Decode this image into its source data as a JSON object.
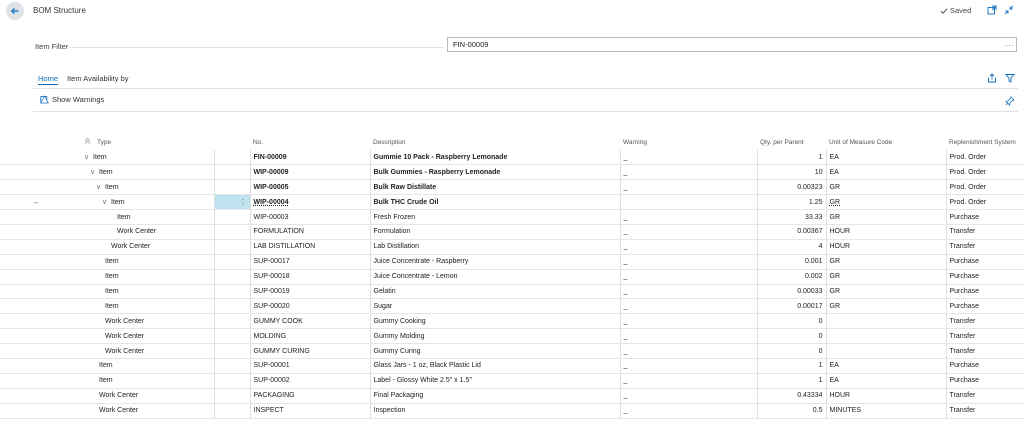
{
  "header": {
    "title": "BOM Structure",
    "saved_label": "Saved"
  },
  "filter": {
    "label": "Item Filter",
    "value": "FIN-00009",
    "more": "···"
  },
  "tabs": [
    {
      "label": "Home"
    },
    {
      "label": "Item Availability by"
    }
  ],
  "actions": {
    "show_warnings": "Show Warnings"
  },
  "columns": [
    "Type",
    "No.",
    "Description",
    "Warning",
    "Qty. per Parent",
    "Unit of Measure Code",
    "Replenishment System"
  ],
  "rows": [
    {
      "type": "Item",
      "level": 0,
      "expand": true,
      "no": "FIN-00009",
      "desc": "Gummie 10 Pack - Raspberry Lemonade",
      "warning": "_",
      "qty": "1",
      "uom": "EA",
      "repl": "Prod. Order",
      "bold": true
    },
    {
      "type": "Item",
      "level": 1,
      "expand": true,
      "no": "WIP-00009",
      "desc": "Bulk Gummies - Raspberry Lemonade",
      "warning": "_",
      "qty": "10",
      "uom": "EA",
      "repl": "Prod. Order",
      "bold": true
    },
    {
      "type": "Item",
      "level": 2,
      "expand": true,
      "no": "WIP-00005",
      "desc": "Bulk Raw Distillate",
      "warning": "_",
      "qty": "0.00323",
      "uom": "GR",
      "repl": "Prod. Order",
      "bold": true
    },
    {
      "type": "Item",
      "level": 3,
      "expand": true,
      "no": "WIP-00004",
      "desc": "Bulk THC Crude Oil",
      "warning": "",
      "qty": "1.25",
      "uom": "GR",
      "repl": "Prod. Order",
      "bold": true,
      "selected": true
    },
    {
      "type": "Item",
      "level": 4,
      "expand": false,
      "no": "WIP-00003",
      "desc": "Fresh Frozen",
      "warning": "_",
      "qty": "33.33",
      "uom": "GR",
      "repl": "Purchase",
      "bold": false
    },
    {
      "type": "Work Center",
      "level": 4,
      "expand": false,
      "no": "FORMULATION",
      "desc": "Formulation",
      "warning": "_",
      "qty": "0.00367",
      "uom": "HOUR",
      "repl": "Transfer",
      "bold": false
    },
    {
      "type": "Work Center",
      "level": 3,
      "expand": false,
      "no": "LAB DISTILLATION",
      "desc": "Lab Distillation",
      "warning": "_",
      "qty": "4",
      "uom": "HOUR",
      "repl": "Transfer",
      "bold": false
    },
    {
      "type": "Item",
      "level": 2,
      "expand": false,
      "no": "SUP-00017",
      "desc": "Juice Concentrate - Raspberry",
      "warning": "_",
      "qty": "0.001",
      "uom": "GR",
      "repl": "Purchase",
      "bold": false
    },
    {
      "type": "Item",
      "level": 2,
      "expand": false,
      "no": "SUP-00018",
      "desc": "Juice Concentrate - Lemon",
      "warning": "_",
      "qty": "0.002",
      "uom": "GR",
      "repl": "Purchase",
      "bold": false
    },
    {
      "type": "Item",
      "level": 2,
      "expand": false,
      "no": "SUP-00019",
      "desc": "Gelatin",
      "warning": "_",
      "qty": "0.00033",
      "uom": "GR",
      "repl": "Purchase",
      "bold": false
    },
    {
      "type": "Item",
      "level": 2,
      "expand": false,
      "no": "SUP-00020",
      "desc": "Sugar",
      "warning": "_",
      "qty": "0.00017",
      "uom": "GR",
      "repl": "Purchase",
      "bold": false
    },
    {
      "type": "Work Center",
      "level": 2,
      "expand": false,
      "no": "GUMMY COOK",
      "desc": "Gummy Cooking",
      "warning": "_",
      "qty": "0",
      "uom": "",
      "repl": "Transfer",
      "bold": false
    },
    {
      "type": "Work Center",
      "level": 2,
      "expand": false,
      "no": "MOLDING",
      "desc": "Gummy Molding",
      "warning": "_",
      "qty": "0",
      "uom": "",
      "repl": "Transfer",
      "bold": false
    },
    {
      "type": "Work Center",
      "level": 2,
      "expand": false,
      "no": "GUMMY CURING",
      "desc": "Gummy Curing",
      "warning": "_",
      "qty": "0",
      "uom": "",
      "repl": "Transfer",
      "bold": false
    },
    {
      "type": "Item",
      "level": 1,
      "expand": false,
      "no": "SUP-00001",
      "desc": "Glass Jars - 1 oz, Black Plastic Lid",
      "warning": "_",
      "qty": "1",
      "uom": "EA",
      "repl": "Purchase",
      "bold": false
    },
    {
      "type": "Item",
      "level": 1,
      "expand": false,
      "no": "SUP-00002",
      "desc": "Label - Glossy White 2.5\" x 1.5\"",
      "warning": "_",
      "qty": "1",
      "uom": "EA",
      "repl": "Purchase",
      "bold": false
    },
    {
      "type": "Work Center",
      "level": 1,
      "expand": false,
      "no": "PACKAGING",
      "desc": "Final Packaging",
      "warning": "_",
      "qty": "0.43334",
      "uom": "HOUR",
      "repl": "Transfer",
      "bold": false
    },
    {
      "type": "Work Center",
      "level": 1,
      "expand": false,
      "no": "INSPECT",
      "desc": "Inspection",
      "warning": "_",
      "qty": "0.5",
      "uom": "MINUTES",
      "repl": "Transfer",
      "bold": false
    }
  ],
  "colors": {
    "accent": "#0f6cbd",
    "selected_cell": "#bfe3ee"
  }
}
